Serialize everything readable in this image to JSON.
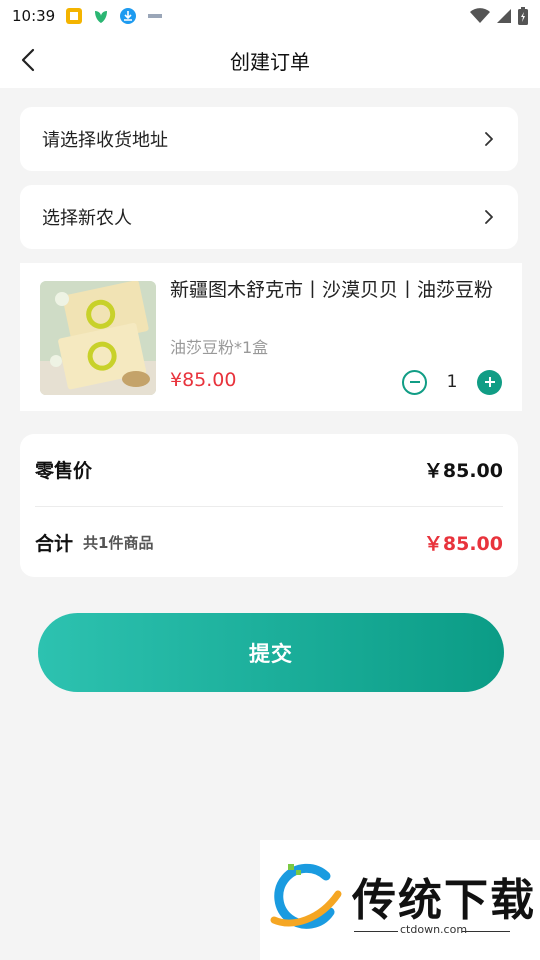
{
  "status_bar": {
    "time": "10:39"
  },
  "header": {
    "title": "创建订单"
  },
  "address_row": {
    "label": "请选择收货地址"
  },
  "farmer_row": {
    "label": "选择新农人"
  },
  "product": {
    "title": "新疆图木舒克市丨沙漠贝贝丨油莎豆粉",
    "spec": "油莎豆粉*1盒",
    "price": "¥85.00",
    "quantity": "1"
  },
  "summary": {
    "retail_label": "零售价",
    "retail_value": "￥85.00",
    "total_label": "合计",
    "total_count": "共1件商品",
    "total_value": "￥85.00"
  },
  "submit": {
    "label": "提交"
  },
  "watermark": {
    "name": "传统下载",
    "url": "ctdown.com"
  },
  "colors": {
    "accent": "#119d85",
    "price_red": "#e8333c"
  },
  "icons": [
    "back-arrow-icon",
    "chevron-right-icon",
    "minus-circle-icon",
    "plus-circle-icon",
    "wifi-icon",
    "signal-icon",
    "battery-icon"
  ]
}
